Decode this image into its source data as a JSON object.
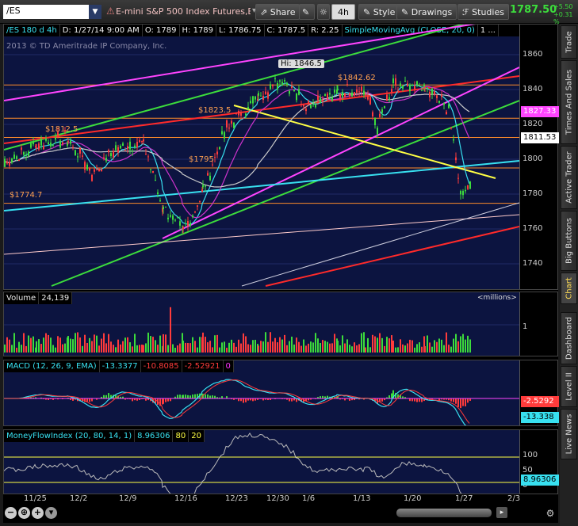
{
  "toolbar": {
    "symbol": "/ES",
    "instrument_title": "E-mini S&P 500 Index Futures,ETH...",
    "share_label": "Share",
    "aggregation": "4h",
    "style_label": "Style",
    "drawings_label": "Drawings",
    "studies_label": "Studies",
    "last_price": "1787.50",
    "change_abs": "+5.50",
    "change_pct": "+0.31 %"
  },
  "price_pane": {
    "header": {
      "symbol_period": "/ES 180 d 4h",
      "date": "D: 1/27/14 9:00 AM",
      "open": "O: 1789",
      "high": "H: 1789",
      "low": "L: 1786.75",
      "close": "C: 1787.5",
      "range": "R: 2.25",
      "study": "SimpleMovingAvg (CLOSE, 20, 0)",
      "more": "1 ..."
    },
    "copyright": "2013 © TD Ameritrade IP Company, Inc.",
    "y_ticks": [
      "1860",
      "1840",
      "1820",
      "1800",
      "1780",
      "1760",
      "1740"
    ],
    "annotations": {
      "hi": "Hi: 1846.5",
      "a1842": "$1842.62",
      "a1823": "$1823.5",
      "a1812": "$1812.5",
      "a1795": "$1795",
      "a1774": "$1774.7"
    },
    "tags": {
      "t1827": "1827.33",
      "t1811": "1811.53"
    }
  },
  "volume_pane": {
    "label": "Volume",
    "value": "24,139",
    "units": "<millions>",
    "tick": "1"
  },
  "macd_pane": {
    "label": "MACD (12, 26, 9, EMA)",
    "value": "-13.3377",
    "avg": "-10.8085",
    "diff": "-2.52921",
    "zero": "0",
    "tag_diff": "-2.5292",
    "tag_value": "-13.338"
  },
  "mfi_pane": {
    "label": "MoneyFlowIndex (20, 80, 14, 1)",
    "value": "8.96306",
    "overbought": "80",
    "oversold": "20",
    "ticks": [
      "100",
      "50",
      "0"
    ],
    "tag_value": "8.96306"
  },
  "x_axis": {
    "labels": [
      "11/25",
      "12/2",
      "12/9",
      "12/16",
      "12/23",
      "12/30",
      "1/6",
      "1/13",
      "1/20",
      "1/27",
      "2/3"
    ]
  },
  "side_tabs": [
    "Trade",
    "Times And Sales",
    "Active Trader",
    "Big Buttons",
    "Chart",
    "Dashboard",
    "Level II",
    "Live News"
  ],
  "colors": {
    "up": "#3cdc3c",
    "down": "#ff3b3b",
    "pane_bg": "#0c1440",
    "sma_cyan": "#38e0f0"
  }
}
